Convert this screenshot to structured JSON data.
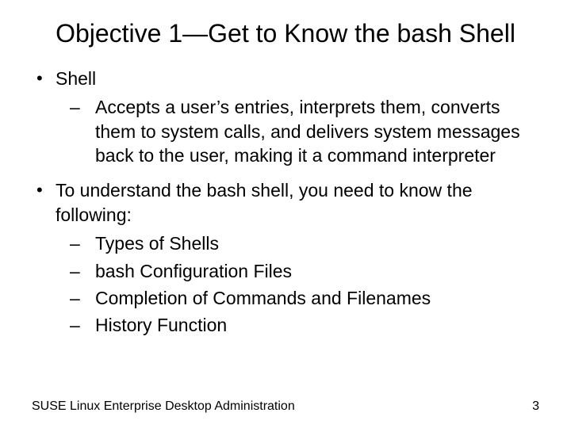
{
  "title": "Objective 1—Get to Know the bash Shell",
  "bullets": {
    "b0": {
      "label": "Shell",
      "sub0": "Accepts a user’s entries, interprets them, converts them to system calls, and delivers system messages back to the user, making it a command interpreter"
    },
    "b1": {
      "label": "To understand the bash shell, you need to know the following:",
      "sub0": "Types of Shells",
      "sub1": "bash Configuration Files",
      "sub2": "Completion of Commands and Filenames",
      "sub3": "History Function"
    }
  },
  "footer": {
    "left": "SUSE Linux Enterprise Desktop Administration",
    "right": "3"
  }
}
